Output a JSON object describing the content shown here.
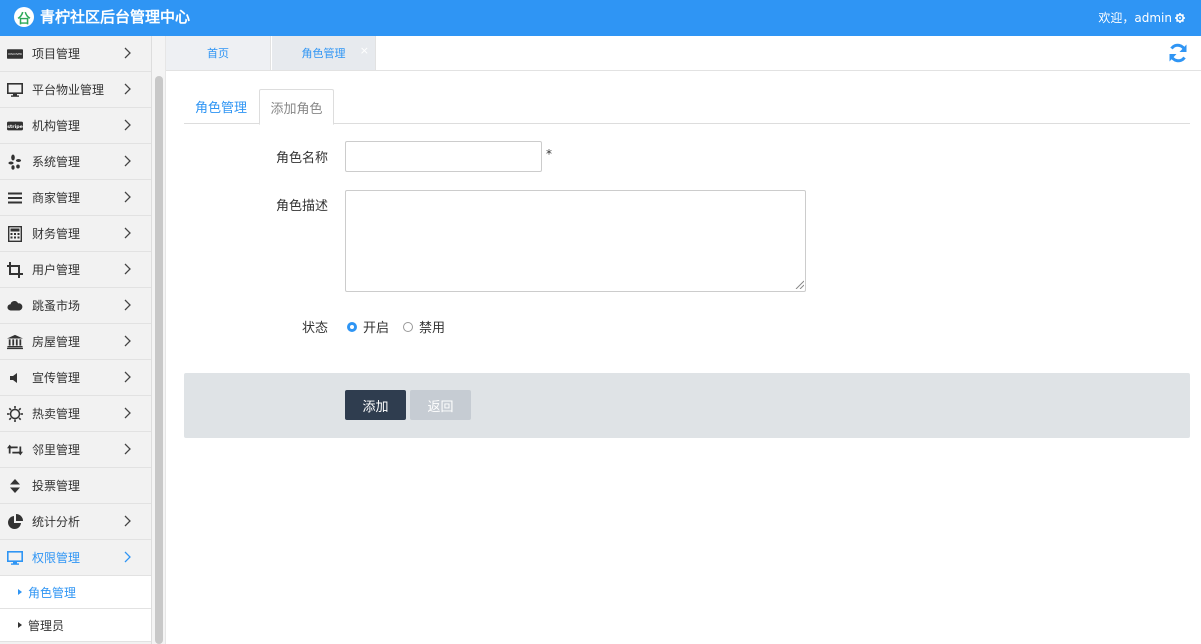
{
  "header": {
    "title": "青柠社区后台管理中心",
    "welcome": "欢迎，admin",
    "logo_glyph": "㕣"
  },
  "sidebar": {
    "items": [
      {
        "label": "项目管理",
        "icon": "discover-card-icon"
      },
      {
        "label": "平台物业管理",
        "icon": "monitor-icon"
      },
      {
        "label": "机构管理",
        "icon": "stripe-icon"
      },
      {
        "label": "系统管理",
        "icon": "yelp-icon"
      },
      {
        "label": "商家管理",
        "icon": "list-icon"
      },
      {
        "label": "财务管理",
        "icon": "calculator-icon"
      },
      {
        "label": "用户管理",
        "icon": "crop-icon"
      },
      {
        "label": "跳蚤市场",
        "icon": "cloud-icon"
      },
      {
        "label": "房屋管理",
        "icon": "bank-icon"
      },
      {
        "label": "宣传管理",
        "icon": "volume-icon"
      },
      {
        "label": "热卖管理",
        "icon": "sun-icon"
      },
      {
        "label": "邻里管理",
        "icon": "retweet-icon"
      },
      {
        "label": "投票管理",
        "icon": "sort-icon"
      },
      {
        "label": "统计分析",
        "icon": "pie-chart-icon"
      },
      {
        "label": "权限管理",
        "icon": "monitor-icon"
      }
    ],
    "stripe_text": "stripe",
    "discover_text": "DISCOVER",
    "subitems": [
      {
        "label": "角色管理"
      },
      {
        "label": "管理员"
      }
    ]
  },
  "tabs": [
    {
      "label": "首页"
    },
    {
      "label": "角色管理"
    }
  ],
  "tab_close": "×",
  "subtabs": [
    {
      "label": "角色管理"
    },
    {
      "label": "添加角色"
    }
  ],
  "form": {
    "name_label": "角色名称",
    "name_value": "",
    "required_mark": "*",
    "desc_label": "角色描述",
    "desc_value": "",
    "status_label": "状态",
    "status_options": [
      {
        "label": "开启",
        "checked": true
      },
      {
        "label": "禁用",
        "checked": false
      }
    ]
  },
  "actions": {
    "add_label": "添加",
    "back_label": "返回"
  },
  "colors": {
    "accent": "#2f95f4",
    "header_bg": "#2f95f4",
    "primary_button": "#2f3d4f",
    "disabled_button": "#c6ccd3"
  }
}
